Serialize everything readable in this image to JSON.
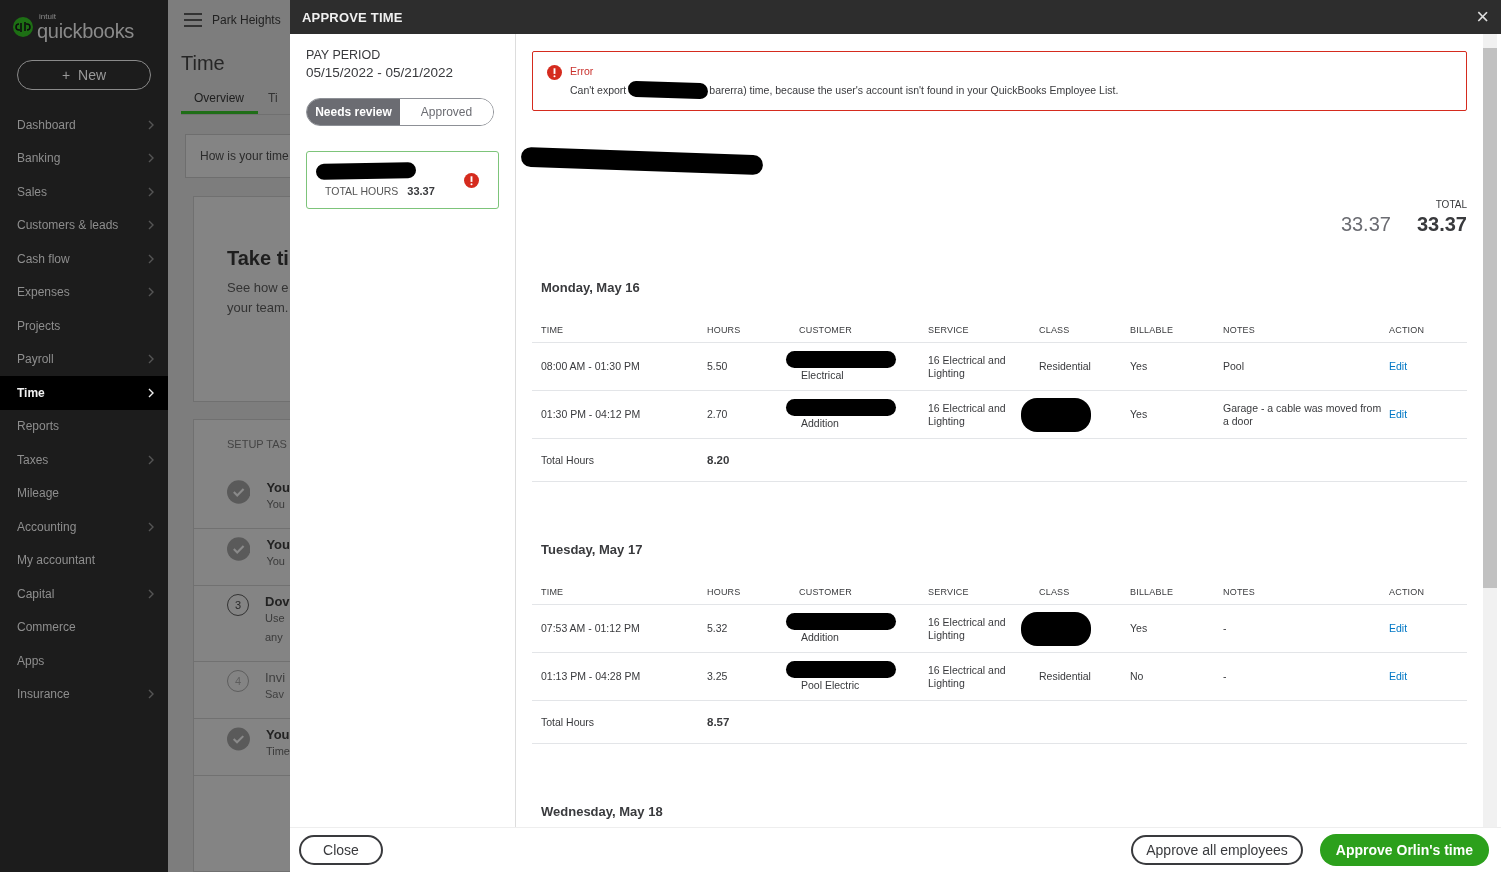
{
  "sidebar": {
    "logo": {
      "small": "intuit",
      "brand": "quickbooks"
    },
    "new_button": {
      "icon": "+",
      "label": "New"
    },
    "items": [
      {
        "label": "Dashboard",
        "chevron": true,
        "selected": false
      },
      {
        "label": "Banking",
        "chevron": true,
        "selected": false
      },
      {
        "label": "Sales",
        "chevron": true,
        "selected": false
      },
      {
        "label": "Customers & leads",
        "chevron": true,
        "selected": false
      },
      {
        "label": "Cash flow",
        "chevron": true,
        "selected": false
      },
      {
        "label": "Expenses",
        "chevron": true,
        "selected": false
      },
      {
        "label": "Projects",
        "chevron": false,
        "selected": false
      },
      {
        "label": "Payroll",
        "chevron": true,
        "selected": false
      },
      {
        "label": "Time",
        "chevron": true,
        "selected": true
      },
      {
        "label": "Reports",
        "chevron": false,
        "selected": false
      },
      {
        "label": "Taxes",
        "chevron": true,
        "selected": false
      },
      {
        "label": "Mileage",
        "chevron": false,
        "selected": false
      },
      {
        "label": "Accounting",
        "chevron": true,
        "selected": false
      },
      {
        "label": "My accountant",
        "chevron": false,
        "selected": false
      },
      {
        "label": "Capital",
        "chevron": true,
        "selected": false
      },
      {
        "label": "Commerce",
        "chevron": false,
        "selected": false
      },
      {
        "label": "Apps",
        "chevron": false,
        "selected": false
      },
      {
        "label": "Insurance",
        "chevron": true,
        "selected": false
      }
    ]
  },
  "background_page": {
    "company": "Park Heights",
    "title": "Time",
    "tabs": [
      {
        "label": "Overview",
        "selected": true
      },
      {
        "label": "Ti",
        "selected": false
      }
    ],
    "prompt": "How is your time",
    "promo": {
      "title": "Take ti",
      "lines": [
        "See how e",
        "your team."
      ]
    },
    "setup": {
      "title": "SETUP TAS",
      "tasks": [
        {
          "kind": "done",
          "title": "You",
          "lines": [
            "You"
          ],
          "disabled": false
        },
        {
          "kind": "done",
          "title": "You",
          "lines": [
            "You"
          ],
          "disabled": false
        },
        {
          "kind": "step",
          "number": "3",
          "title": "Dov",
          "lines": [
            "Use",
            "any"
          ],
          "disabled": false
        },
        {
          "kind": "step",
          "number": "4",
          "title": "Invi",
          "lines": [
            "Sav"
          ],
          "disabled": true
        },
        {
          "kind": "done",
          "title": "You",
          "lines": [
            "Time"
          ],
          "disabled": false
        }
      ]
    }
  },
  "modal": {
    "title": "APPROVE TIME",
    "close_icon": "×",
    "pay_period": {
      "label": "PAY PERIOD",
      "range": "05/15/2022 - 05/21/2022"
    },
    "filter": [
      {
        "label": "Needs review",
        "selected": true
      },
      {
        "label": "Approved",
        "selected": false
      }
    ],
    "employees": [
      {
        "name_redacted": true,
        "total_label": "TOTAL HOURS",
        "total": "33.37",
        "error": true,
        "selected": true
      }
    ],
    "error": {
      "title": "Error",
      "text_before": "Can't export",
      "redacted": true,
      "text_after": "barerra) time, because the user's account isn't found in your QuickBooks Employee List."
    },
    "employee_name_redacted": true,
    "total": {
      "label": "TOTAL",
      "value": "33.37",
      "value_bold": "33.37"
    },
    "days": [
      {
        "heading": "Monday, May 16",
        "columns": [
          "TIME",
          "HOURS",
          "CUSTOMER",
          "SERVICE",
          "CLASS",
          "BILLABLE",
          "NOTES",
          "ACTION"
        ],
        "rows": [
          {
            "time": "08:00 AM - 01:30 PM",
            "hours": "5.50",
            "customer": {
              "redacted": true,
              "detail": "Electrical"
            },
            "service": "16 Electrical and Lighting",
            "class": "Residential",
            "billable": "Yes",
            "notes": "Pool",
            "action": "Edit"
          },
          {
            "time": "01:30 PM - 04:12 PM",
            "hours": "2.70",
            "customer": {
              "redacted": true,
              "detail": "Addition"
            },
            "service": "16 Electrical and Lighting",
            "class_redacted": true,
            "billable": "Yes",
            "notes": "Garage - a cable was moved from a door",
            "action": "Edit"
          }
        ],
        "total_label": "Total Hours",
        "total": "8.20"
      },
      {
        "heading": "Tuesday, May 17",
        "columns": [
          "TIME",
          "HOURS",
          "CUSTOMER",
          "SERVICE",
          "CLASS",
          "BILLABLE",
          "NOTES",
          "ACTION"
        ],
        "rows": [
          {
            "time": "07:53 AM - 01:12 PM",
            "hours": "5.32",
            "customer": {
              "redacted": true,
              "detail": "Addition"
            },
            "service": "16 Electrical and Lighting",
            "class_redacted": true,
            "billable": "Yes",
            "notes": "-",
            "action": "Edit"
          },
          {
            "time": "01:13 PM - 04:28 PM",
            "hours": "3.25",
            "customer": {
              "redacted": true,
              "detail": "Pool Electric"
            },
            "service": "16 Electrical and Lighting",
            "class": "Residential",
            "billable": "No",
            "notes": "-",
            "action": "Edit"
          }
        ],
        "total_label": "Total Hours",
        "total": "8.57"
      },
      {
        "heading": "Wednesday, May 18"
      }
    ],
    "footer": {
      "close": "Close",
      "approve_all": "Approve all employees",
      "approve_one": "Approve Orlin's time"
    }
  }
}
